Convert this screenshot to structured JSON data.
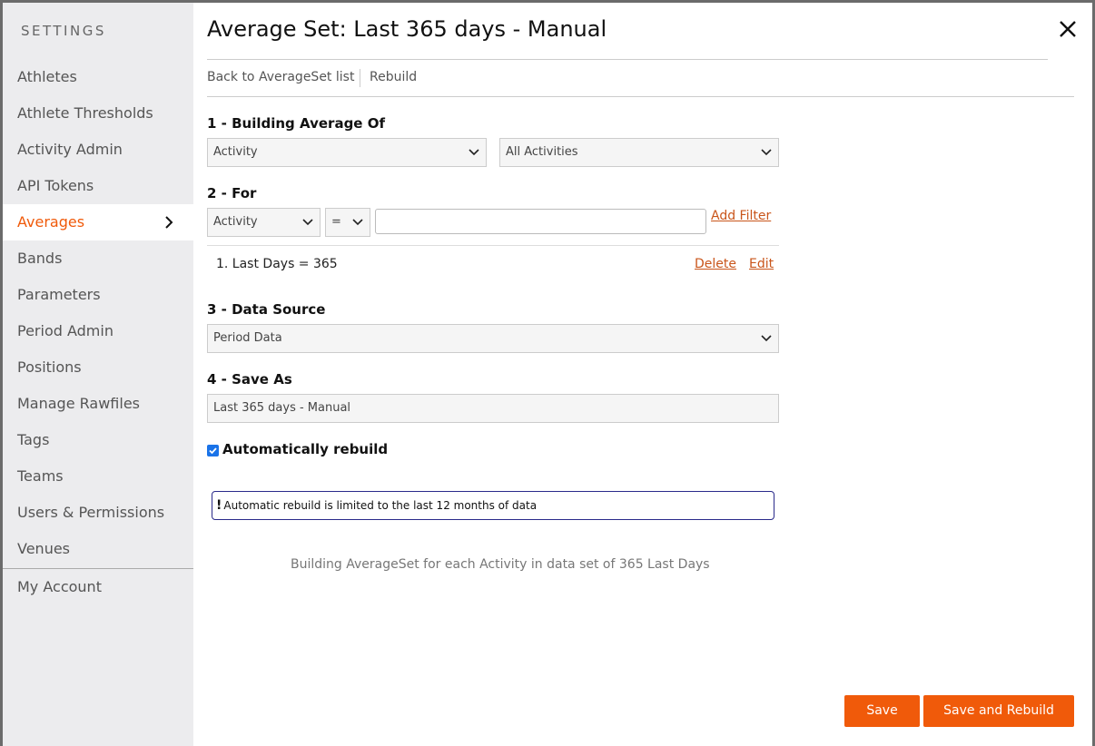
{
  "sidebar": {
    "header": "SETTINGS",
    "items": [
      {
        "label": "Athletes"
      },
      {
        "label": "Athlete Thresholds"
      },
      {
        "label": "Activity Admin"
      },
      {
        "label": "API Tokens"
      },
      {
        "label": "Averages",
        "active": true
      },
      {
        "label": "Bands"
      },
      {
        "label": "Parameters"
      },
      {
        "label": "Period Admin"
      },
      {
        "label": "Positions"
      },
      {
        "label": "Manage Rawfiles"
      },
      {
        "label": "Tags"
      },
      {
        "label": "Teams"
      },
      {
        "label": "Users & Permissions"
      },
      {
        "label": "Venues"
      }
    ],
    "footer_item": "My Account",
    "active_color": "#f05a0a"
  },
  "main": {
    "title": "Average Set: Last 365 days - Manual",
    "links": {
      "back": "Back to AverageSet list",
      "rebuild": "Rebuild"
    },
    "section1": {
      "title": "1 - Building Average Of",
      "select_type": "Activity",
      "select_scope": "All Activities"
    },
    "section2": {
      "title": "2 - For",
      "filter_field": "Activity",
      "filter_operator": "=",
      "filter_value": "",
      "add_filter": "Add Filter",
      "filters": [
        {
          "label": "1. Last Days = 365",
          "delete": "Delete",
          "edit": "Edit"
        }
      ]
    },
    "section3": {
      "title": "3 - Data Source",
      "select": "Period Data"
    },
    "section4": {
      "title": "4 - Save As",
      "value": "Last 365 days - Manual"
    },
    "auto_rebuild": {
      "label": "Automatically rebuild",
      "checked": true
    },
    "alert": "Automatic rebuild is limited to the last 12 months of data",
    "summary": "Building AverageSet for each Activity in data set of 365 Last Days",
    "buttons": {
      "save": "Save",
      "save_rebuild": "Save and Rebuild"
    },
    "accent_color": "#f05a0a",
    "icons": {
      "close": "close-icon",
      "chevron": "chevron-right-icon",
      "caret": "chevron-down-icon"
    }
  }
}
